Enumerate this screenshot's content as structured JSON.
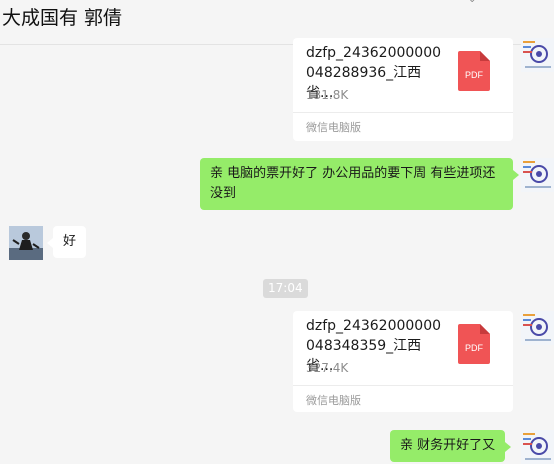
{
  "header": {
    "title": "大成国有 郭倩",
    "title_icon": "more-icon"
  },
  "colors": {
    "bubble_self": "#95ec69",
    "bubble_other": "#ffffff",
    "pdf_icon": "#f05455",
    "background": "#f5f5f5"
  },
  "messages": [
    {
      "type": "file",
      "sender": "self",
      "name": "dzfp_24362000000048288936_江西省...",
      "size": "131.8K",
      "source": "微信电脑版",
      "icon_label": "PDF"
    },
    {
      "type": "text",
      "sender": "self",
      "text": "亲 电脑的票开好了 办公用品的要下周 有些进项还没到"
    },
    {
      "type": "text",
      "sender": "other",
      "text": "好"
    },
    {
      "type": "time",
      "text": "17:04"
    },
    {
      "type": "file",
      "sender": "self",
      "name": "dzfp_24362000000048348359_江西省...",
      "size": "327.4K",
      "source": "微信电脑版",
      "icon_label": "PDF"
    },
    {
      "type": "text",
      "sender": "self",
      "text": "亲 财务开好了又"
    }
  ]
}
